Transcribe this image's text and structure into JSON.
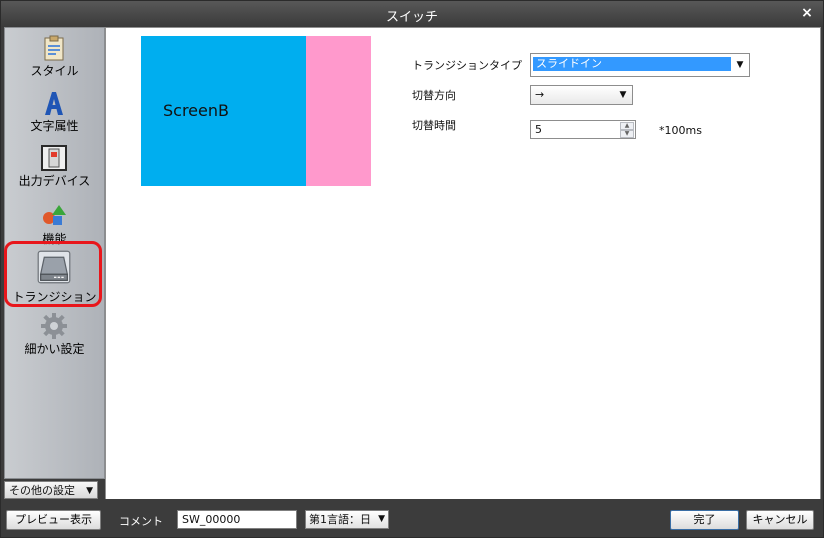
{
  "window": {
    "title": "スイッチ",
    "close_icon": "close-icon"
  },
  "sidebar": {
    "items": [
      {
        "label": "スタイル",
        "icon": "clipboard-icon"
      },
      {
        "label": "文字属性",
        "icon": "letter-a-icon"
      },
      {
        "label": "出力デバイス",
        "icon": "device-icon"
      },
      {
        "label": "機能",
        "icon": "shapes-icon"
      },
      {
        "label": "トランジション",
        "icon": "drive-icon"
      },
      {
        "label": "細かい設定",
        "icon": "gear-icon"
      }
    ],
    "bottom_label": "その他の設定"
  },
  "preview": {
    "label": "ScreenB",
    "colors": {
      "left": "#00aeef",
      "right": "#ff99cc"
    }
  },
  "settings": {
    "transition_type_label": "トランジションタイプ",
    "transition_type_value": "スライドイン",
    "direction_label": "切替方向",
    "direction_value": "→",
    "time_label": "切替時間",
    "time_value": "5",
    "time_unit": "*100ms"
  },
  "footer": {
    "preview_button": "プレビュー表示",
    "comment_label": "コメント",
    "comment_value": "SW_00000",
    "language_select": "第1言語：日",
    "done_button": "完了",
    "cancel_button": "キャンセル"
  }
}
